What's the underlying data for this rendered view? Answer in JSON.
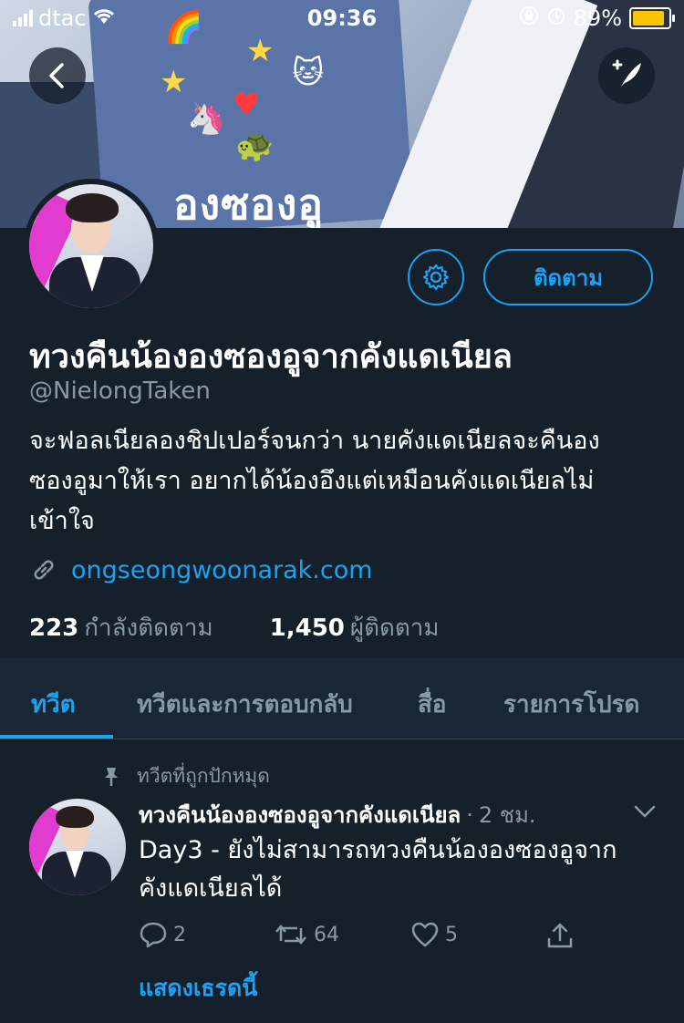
{
  "status_bar": {
    "carrier": "dtac",
    "time": "09:36",
    "battery_percent": "89%",
    "battery_level": 0.89,
    "battery_color": "#f7c600"
  },
  "banner": {
    "text": "องซองอู"
  },
  "header_buttons": {
    "back_icon": "back-arrow-icon",
    "compose_icon": "compose-quill-icon"
  },
  "profile": {
    "follow_label": "ติดตาม",
    "display_name": "ทวงคืนน้ององซองอูจากคังแดเนียล",
    "handle": "@NielongTaken",
    "bio_lines": [
      "จะฟอลเนียลองชิปเปอร์จนกว่า นายคังแดเนียลจะคืนอง",
      "ซองอูมาให้เรา อยากได้น้องอึงแต่เหมือนคังแดเนียลไม่",
      "เข้าใจ"
    ],
    "link": "ongseongwoonarak.com",
    "following_count": "223",
    "following_label": "กำลังติดตาม",
    "followers_count": "1,450",
    "followers_label": "ผู้ติดตาม"
  },
  "tabs": [
    {
      "label": "ทวีต",
      "active": true
    },
    {
      "label": "ทวีตและการตอบกลับ",
      "active": false
    },
    {
      "label": "สื่อ",
      "active": false
    },
    {
      "label": "รายการโปรด",
      "active": false
    }
  ],
  "pinned_tweet": {
    "pinned_label": "ทวีตที่ถูกปักหมุด",
    "author": "ทวงคืนน้ององซองอูจากคังแดเนียล",
    "time": "2 ชม.",
    "text_lines": [
      "Day3 - ยังไม่สามารถทวงคืนน้ององซองอูจาก",
      "คังแดเนียลได้"
    ],
    "replies": "2",
    "retweets": "64",
    "likes": "5",
    "show_thread": "แสดงเธรดนี้"
  },
  "colors": {
    "background": "#15202b",
    "accent": "#1da1f2",
    "secondary_text": "#8899a6"
  }
}
